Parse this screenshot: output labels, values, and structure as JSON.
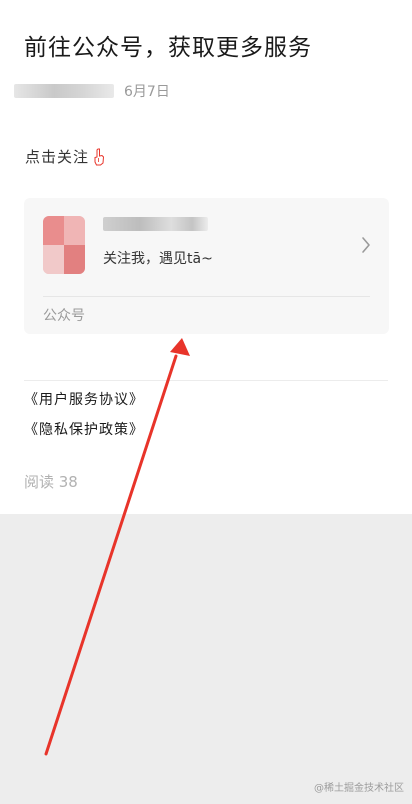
{
  "article": {
    "title": "前往公众号，获取更多服务",
    "date": "6月7日",
    "follow_prompt": "点击关注",
    "links": [
      "《用户服务协议》",
      "《隐私保护政策》"
    ],
    "read_count": "阅读 38"
  },
  "account_card": {
    "slogan": "关注我，遇见tā~",
    "type_label": "公众号"
  },
  "annotation": {
    "arrow_color": "#e8342a"
  },
  "watermark": "@稀土掘金技术社区",
  "colors": {
    "accent_red": "#e8342a",
    "background": "#ededed",
    "card": "#f7f7f7"
  }
}
